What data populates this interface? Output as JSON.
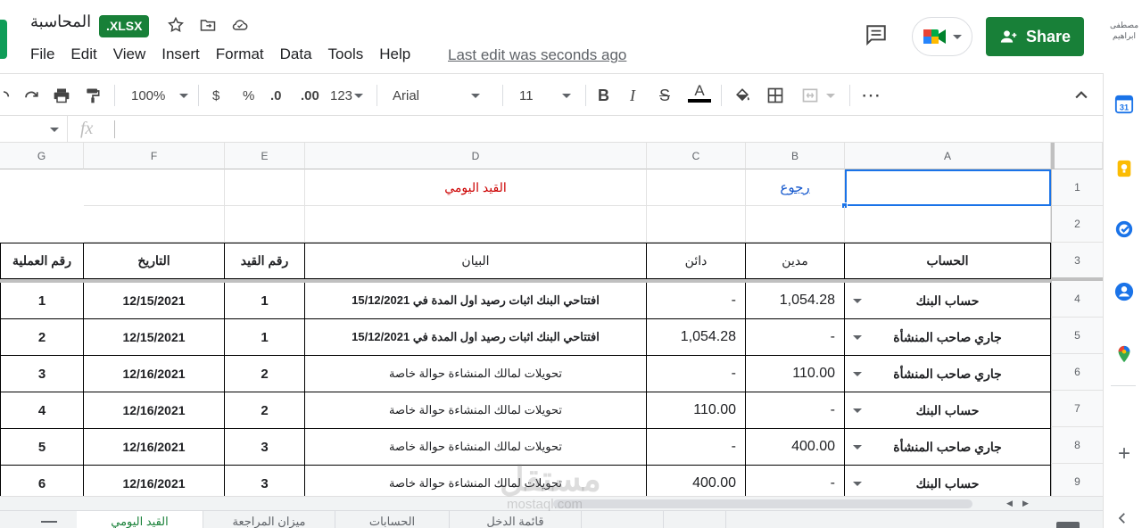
{
  "header": {
    "title": "المحاسبة",
    "badge": ".XLSX",
    "menu": [
      "File",
      "Edit",
      "View",
      "Insert",
      "Format",
      "Data",
      "Tools",
      "Help"
    ],
    "last_edit": "Last edit was seconds ago",
    "share_label": "Share",
    "user_name_line1": "مصطفى",
    "user_name_line2": "ابراهيم"
  },
  "toolbar": {
    "zoom": "100%",
    "currency": "$",
    "percent": "%",
    "dec_less": ".0",
    "dec_more": ".00",
    "more_formats": "123",
    "font": "Arial",
    "font_size": "11"
  },
  "formula_bar": {
    "fx": "fx"
  },
  "columns": [
    "G",
    "F",
    "E",
    "D",
    "C",
    "B",
    "A"
  ],
  "rows": [
    "1",
    "2",
    "3",
    "4",
    "5",
    "6",
    "7",
    "8",
    "9"
  ],
  "sheet": {
    "row1": {
      "b": "رجوع",
      "d": "القيد اليومي"
    },
    "headers": {
      "a": "الحساب",
      "b": "مدين",
      "c": "دائن",
      "d": "البيان",
      "e": "رقم القيد",
      "f": "التاريخ",
      "g": "رقم العملية"
    },
    "data": [
      {
        "a": "حساب البنك",
        "b": "1,054.28",
        "c": "-",
        "d": "افتتاحي البنك  اثبات رصيد اول المدة في 15/12/2021",
        "e": "1",
        "f": "12/15/2021",
        "g": "1"
      },
      {
        "a": "جاري صاحب المنشأة",
        "b": "-",
        "c": "1,054.28",
        "d": "افتتاحي البنك  اثبات رصيد اول المدة في 15/12/2021",
        "e": "1",
        "f": "12/15/2021",
        "g": "2"
      },
      {
        "a": "جاري صاحب المنشأة",
        "b": "110.00",
        "c": "-",
        "d": "تحويلات لمالك المنشاءة  حوالة خاصة",
        "e": "2",
        "f": "12/16/2021",
        "g": "3"
      },
      {
        "a": "حساب البنك",
        "b": "-",
        "c": "110.00",
        "d": "تحويلات لمالك المنشاءة  حوالة خاصة",
        "e": "2",
        "f": "12/16/2021",
        "g": "4"
      },
      {
        "a": "جاري صاحب المنشأة",
        "b": "400.00",
        "c": "-",
        "d": "تحويلات لمالك المنشاءة  حوالة خاصة",
        "e": "3",
        "f": "12/16/2021",
        "g": "5"
      },
      {
        "a": "حساب البنك",
        "b": "-",
        "c": "400.00",
        "d": "تحويلات لمالك المنشاءة  حوالة خاصة",
        "e": "3",
        "f": "12/16/2021",
        "g": "6"
      }
    ]
  },
  "sheet_tabs": [
    "القيد اليومي",
    "ميزان المراجعة",
    "الحسابات",
    "قائمة الدخل"
  ],
  "watermark": {
    "main": "مستقل",
    "sub": "mostaql.com"
  },
  "colors": {
    "accent": "#188038",
    "link": "#1155cc",
    "title_red": "#cc0000",
    "selection": "#1a73e8"
  }
}
